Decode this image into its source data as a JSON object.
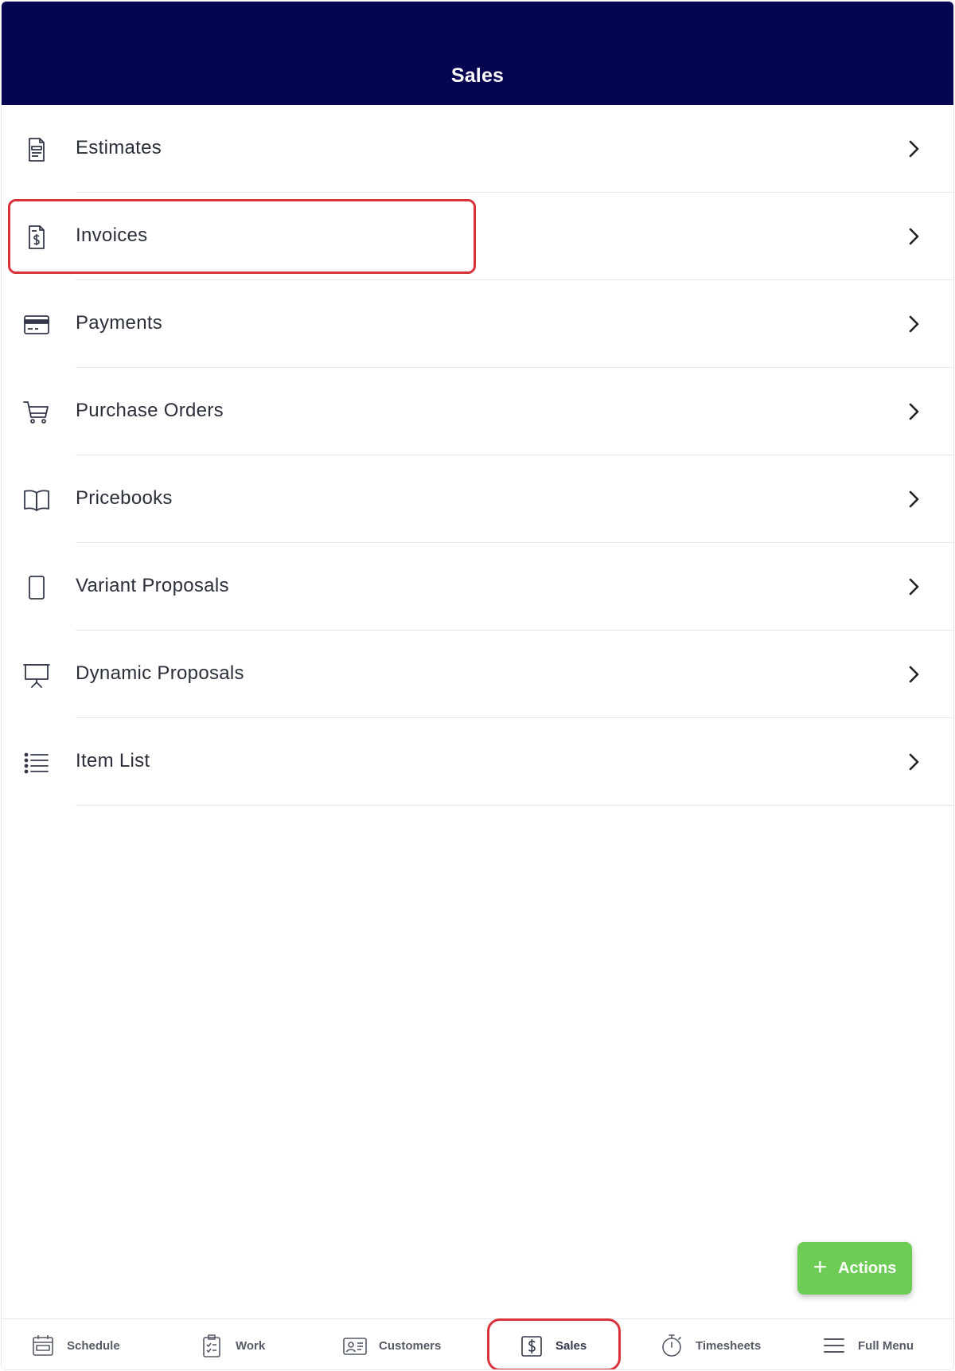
{
  "header": {
    "title": "Sales"
  },
  "menu": {
    "items": [
      {
        "label": "Estimates",
        "icon": "estimate-document-icon"
      },
      {
        "label": "Invoices",
        "icon": "invoice-dollar-icon"
      },
      {
        "label": "Payments",
        "icon": "credit-card-icon"
      },
      {
        "label": "Purchase Orders",
        "icon": "shopping-cart-icon"
      },
      {
        "label": "Pricebooks",
        "icon": "open-book-icon"
      },
      {
        "label": "Variant Proposals",
        "icon": "tablet-icon"
      },
      {
        "label": "Dynamic Proposals",
        "icon": "presentation-board-icon"
      },
      {
        "label": "Item List",
        "icon": "bulleted-list-icon"
      }
    ]
  },
  "actions_button": {
    "label": "Actions"
  },
  "tabbar": {
    "tabs": [
      {
        "label": "Schedule",
        "icon": "calendar-icon"
      },
      {
        "label": "Work",
        "icon": "clipboard-icon"
      },
      {
        "label": "Customers",
        "icon": "contact-card-icon"
      },
      {
        "label": "Sales",
        "icon": "dollar-box-icon",
        "active": true
      },
      {
        "label": "Timesheets",
        "icon": "stopwatch-icon"
      },
      {
        "label": "Full Menu",
        "icon": "hamburger-menu-icon"
      }
    ]
  },
  "colors": {
    "header_bg": "#050550",
    "actions_green": "#6dcc55",
    "highlight_red": "#d8323a",
    "text_dark": "#2a2f3a"
  }
}
